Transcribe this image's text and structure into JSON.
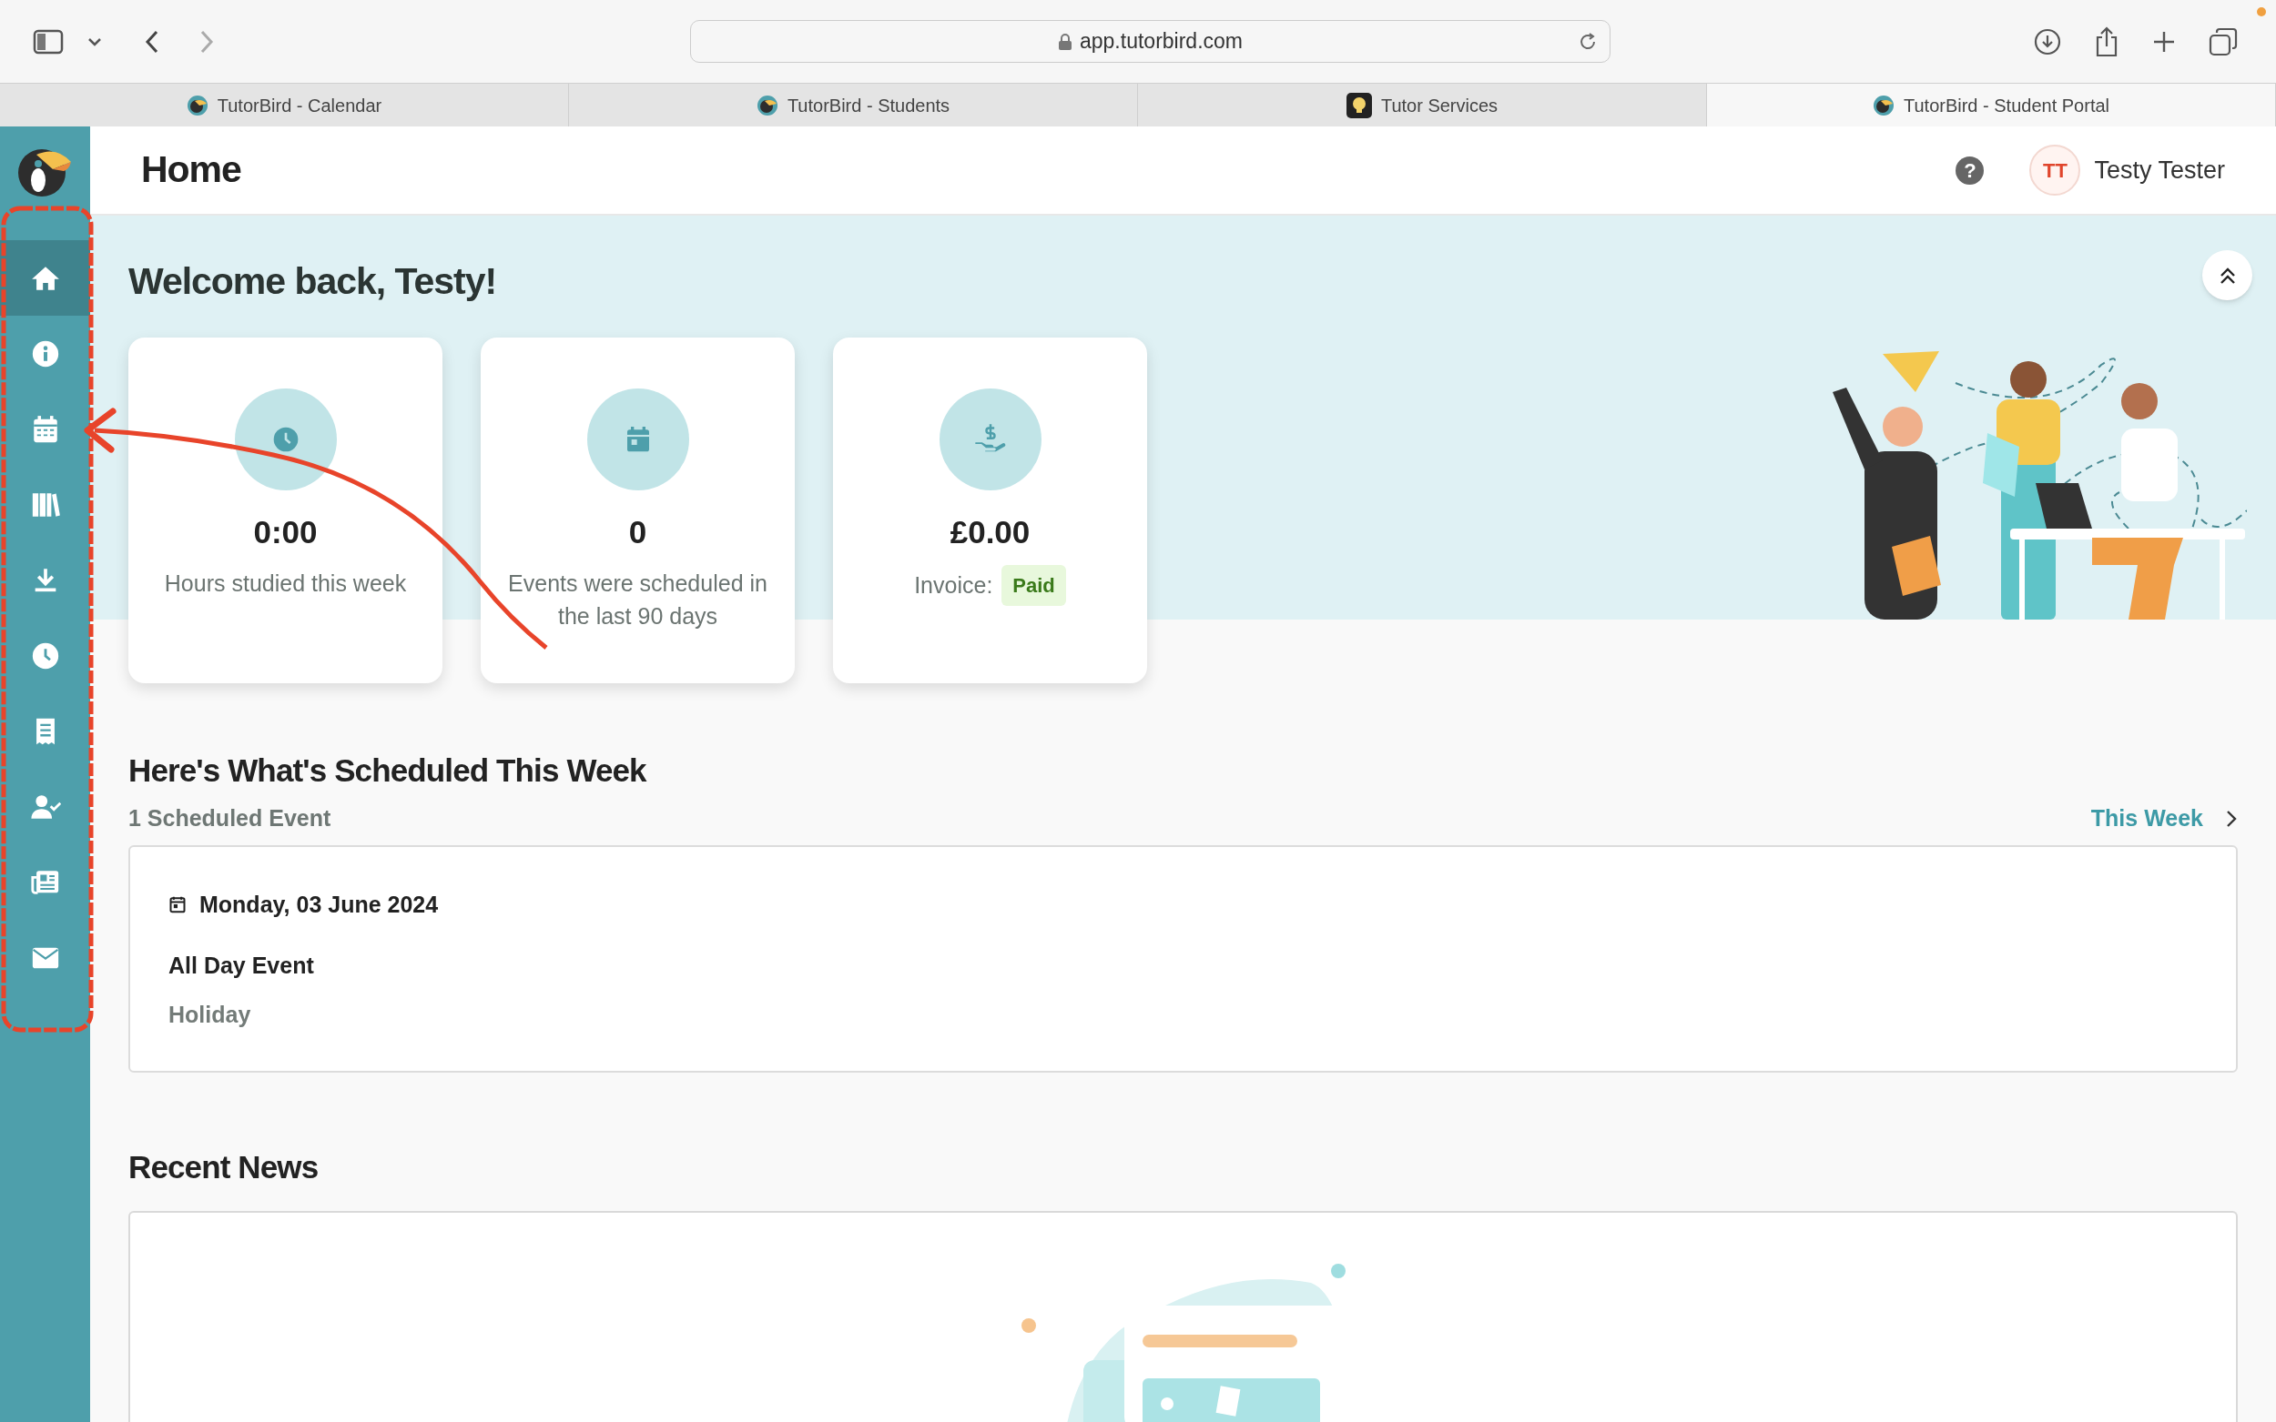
{
  "browser": {
    "url": "app.tutorbird.com",
    "tabs": [
      {
        "kind": "bird",
        "title": "TutorBird - Calendar",
        "selected": false
      },
      {
        "kind": "bird",
        "title": "TutorBird - Students",
        "selected": false
      },
      {
        "kind": "bulb",
        "title": "Tutor Services",
        "selected": false
      },
      {
        "kind": "bird",
        "title": "TutorBird - Student Portal",
        "selected": true
      }
    ]
  },
  "sidebar": {
    "items": [
      {
        "kind": "home",
        "selected": true
      },
      {
        "kind": "info",
        "selected": false
      },
      {
        "kind": "calendar",
        "selected": false
      },
      {
        "kind": "library",
        "selected": false
      },
      {
        "kind": "download",
        "selected": false
      },
      {
        "kind": "clock",
        "selected": false
      },
      {
        "kind": "receipt",
        "selected": false
      },
      {
        "kind": "user-check",
        "selected": false
      },
      {
        "kind": "news",
        "selected": false
      },
      {
        "kind": "mail",
        "selected": false
      }
    ]
  },
  "header": {
    "title": "Home",
    "help": "?",
    "user": {
      "initials": "TT",
      "name": "Testy Tester"
    }
  },
  "welcome": {
    "title": "Welcome back, Testy!"
  },
  "stats": [
    {
      "kind": "clock",
      "value": "0:00",
      "label": "Hours studied this week"
    },
    {
      "kind": "calendar",
      "value": "0",
      "label": "Events were scheduled in the last 90 days"
    },
    {
      "kind": "money",
      "value": "£0.00",
      "label": "Invoice:",
      "badge": "Paid"
    }
  ],
  "schedule": {
    "title": "Here's What's Scheduled This Week",
    "count": "1 Scheduled Event",
    "range": "This Week",
    "events": [
      {
        "date": "Monday, 03 June 2024",
        "title": "All Day Event",
        "type": "Holiday"
      }
    ]
  },
  "news": {
    "title": "Recent News"
  }
}
